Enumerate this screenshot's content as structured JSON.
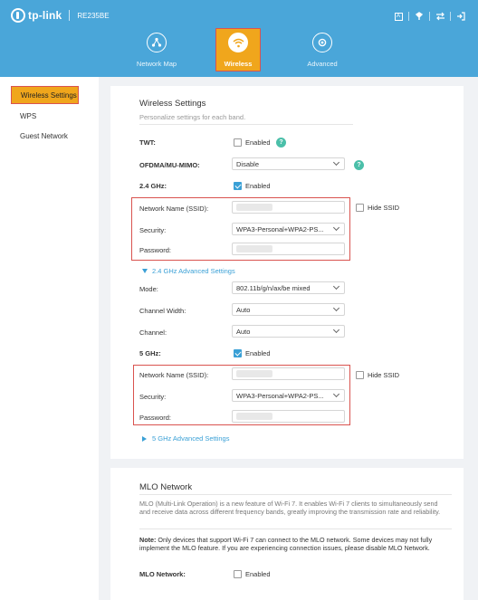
{
  "header": {
    "brand": "tp-link",
    "model": "RE235BE",
    "nav": [
      {
        "label": "Network Map",
        "icon": "network-map-icon"
      },
      {
        "label": "Wireless",
        "icon": "wifi-icon",
        "active": true
      },
      {
        "label": "Advanced",
        "icon": "gear-icon"
      }
    ],
    "top_icons": [
      "language-icon",
      "led-icon",
      "reboot-icon",
      "logout-icon"
    ],
    "lang_letter": "A",
    "accent_color": "#4aa6d9",
    "active_color": "#f0a61c"
  },
  "sidebar": {
    "items": [
      "Wireless Settings",
      "WPS",
      "Guest Network"
    ]
  },
  "wireless": {
    "title": "Wireless Settings",
    "subtitle": "Personalize settings for each band.",
    "twt_label": "TWT:",
    "twt_enabled_label": "Enabled",
    "ofdma_label": "OFDMA/MU-MIMO:",
    "ofdma_value": "Disable",
    "band24_label": "2.4 GHz:",
    "band24_enabled_label": "Enabled",
    "ssid_label": "Network Name (SSID):",
    "hide_ssid_label": "Hide SSID",
    "security_label": "Security:",
    "security_value": "WPA3-Personal+WPA2-PS...",
    "password_label": "Password:",
    "adv24_label": "2.4 GHz Advanced Settings",
    "mode_label": "Mode:",
    "mode_value": "802.11b/g/n/ax/be mixed",
    "width_label": "Channel Width:",
    "width_value": "Auto",
    "channel_label": "Channel:",
    "channel_value": "Auto",
    "band5_label": "5 GHz:",
    "band5_enabled_label": "Enabled",
    "adv5_label": "5 GHz Advanced Settings"
  },
  "mlo": {
    "title": "MLO Network",
    "description": "MLO (Multi-Link Operation) is a new feature of Wi-Fi 7. It enables Wi-Fi 7 clients to simultaneously send and receive data across different frequency bands, greatly improving the transmission rate and reliability.",
    "note_label": "Note:",
    "note_text": " Only devices that support Wi-Fi 7 can connect to the MLO network. Some devices may not fully implement the MLO feature. If you are experiencing connection issues, please disable MLO Network.",
    "mlo_label": "MLO Network:",
    "mlo_enabled_label": "Enabled"
  }
}
